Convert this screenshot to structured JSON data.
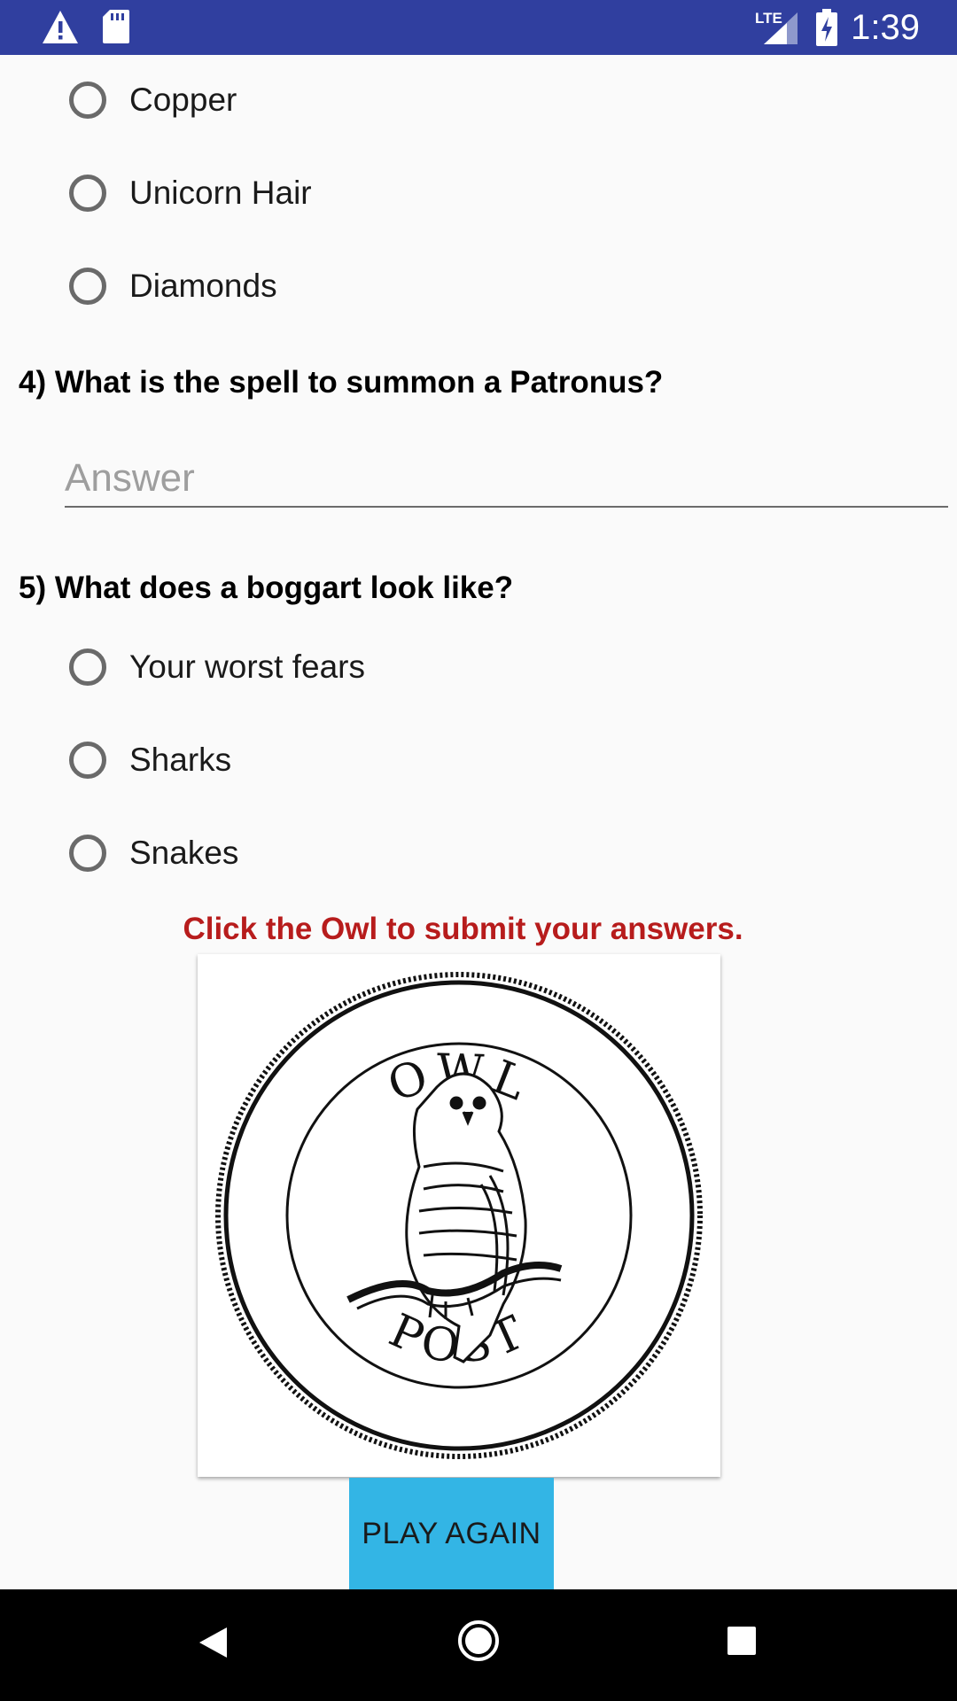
{
  "status_bar": {
    "time": "1:39",
    "network_label": "LTE",
    "icons": [
      "alert-icon",
      "sd-card-icon",
      "signal-icon",
      "battery-charging-icon"
    ]
  },
  "quiz": {
    "q3_options": [
      "Copper",
      "Unicorn Hair",
      "Diamonds"
    ],
    "q4": {
      "question": "4) What is the spell to summon a Patronus?",
      "answer_placeholder": "Answer",
      "answer_value": ""
    },
    "q5": {
      "question": "5) What does a boggart look like?",
      "options": [
        "Your worst fears",
        "Sharks",
        "Snakes"
      ]
    },
    "submit_hint": "Click the Owl to submit your answers.",
    "seal": {
      "top_text": "OWL",
      "bottom_text": "POST"
    },
    "play_again_label": "PLAY AGAIN"
  },
  "colors": {
    "status_bar": "#303f9f",
    "hint_text": "#b71c1c",
    "play_button": "#33b5e5",
    "nav_bar": "#000000"
  },
  "nav_bar": {
    "icons": [
      "back-icon",
      "home-icon",
      "recents-icon"
    ]
  }
}
